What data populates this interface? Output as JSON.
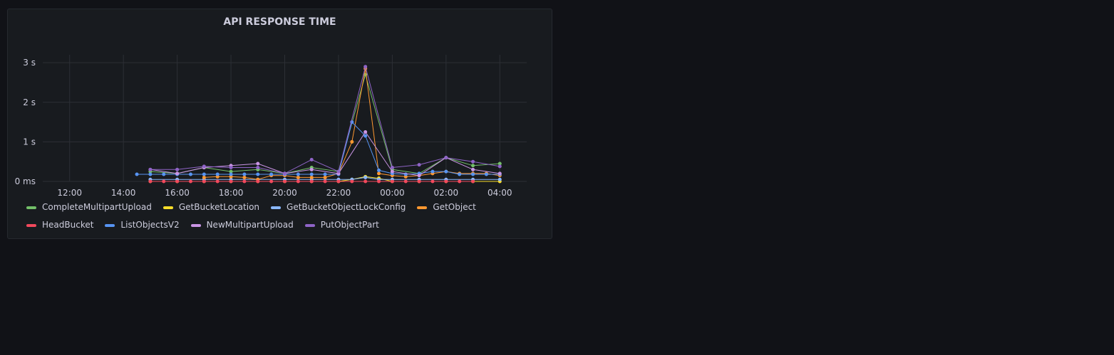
{
  "panel": {
    "title": "API RESPONSE TIME"
  },
  "chart_data": {
    "type": "line",
    "title": "API RESPONSE TIME",
    "xlabel": "",
    "ylabel": "",
    "x_tick_labels": [
      "12:00",
      "14:00",
      "16:00",
      "18:00",
      "20:00",
      "22:00",
      "00:00",
      "02:00",
      "04:00"
    ],
    "x_tick_hours": [
      12,
      14,
      16,
      18,
      20,
      22,
      24,
      26,
      28
    ],
    "xlim_hours": [
      11,
      29
    ],
    "y_ticks": [
      0,
      1,
      2,
      3
    ],
    "y_tick_labels": [
      "0 ms",
      "1 s",
      "2 s",
      "3 s"
    ],
    "ylim": [
      0,
      3.2
    ],
    "grid": true,
    "legend_position": "bottom",
    "series": [
      {
        "name": "CompleteMultipartUpload",
        "color": "#73bf69",
        "x": [
          15,
          16,
          17,
          18,
          19,
          20,
          21,
          22,
          23,
          24,
          25,
          26,
          27,
          28
        ],
        "y": [
          0.25,
          0.2,
          0.35,
          0.25,
          0.3,
          0.2,
          0.35,
          0.25,
          2.7,
          0.3,
          0.2,
          0.6,
          0.4,
          0.45
        ]
      },
      {
        "name": "GetBucketLocation",
        "color": "#fade2a",
        "x": [
          15,
          16,
          17,
          18,
          19,
          20,
          21,
          22,
          22.5,
          23,
          23.5,
          24,
          25,
          26,
          27,
          28
        ],
        "y": [
          0,
          0,
          0,
          0,
          0,
          0,
          0,
          0,
          0.05,
          0.12,
          0.08,
          0,
          0,
          0,
          0,
          0
        ]
      },
      {
        "name": "GetBucketObjectLockConfig",
        "color": "#8ab8ff",
        "x": [
          15,
          16,
          17,
          18,
          19,
          20,
          21,
          22,
          22.5,
          23,
          23.5,
          24,
          25,
          26,
          27,
          28
        ],
        "y": [
          0.05,
          0.05,
          0.05,
          0.05,
          0.05,
          0.05,
          0.05,
          0.05,
          0.05,
          0.1,
          0.05,
          0.05,
          0.05,
          0.05,
          0.05,
          0.05
        ]
      },
      {
        "name": "GetObject",
        "color": "#ff9830",
        "x": [
          17,
          17.5,
          18,
          18.5,
          19,
          19.5,
          20,
          20.5,
          21,
          21.5,
          22,
          22.5,
          23,
          23.5,
          24,
          24.5,
          25,
          25.5,
          26,
          26.5,
          27,
          27.5,
          28
        ],
        "y": [
          0.1,
          0.12,
          0.12,
          0.1,
          0.05,
          0.15,
          0.15,
          0.1,
          0.1,
          0.1,
          0.2,
          1.0,
          2.85,
          0.2,
          0.15,
          0.12,
          0.15,
          0.2,
          0.25,
          0.2,
          0.2,
          0.2,
          0.15
        ]
      },
      {
        "name": "HeadBucket",
        "color": "#f2495c",
        "x": [
          15,
          15.5,
          16,
          16.5,
          17,
          17.5,
          18,
          18.5,
          19,
          19.5,
          20,
          20.5,
          21,
          21.5,
          22,
          22.5,
          23,
          23.5,
          24,
          24.5,
          25,
          25.5,
          26,
          26.5,
          27
        ],
        "y": [
          0,
          0,
          0,
          0,
          0,
          0,
          0,
          0,
          0,
          0,
          0,
          0,
          0,
          0,
          0,
          0,
          0,
          0,
          0,
          0,
          0,
          0,
          0,
          0,
          0
        ]
      },
      {
        "name": "ListObjectsV2",
        "color": "#5794f2",
        "x": [
          14.5,
          15,
          15.5,
          16,
          16.5,
          17,
          17.5,
          18,
          18.5,
          19,
          19.5,
          20,
          20.5,
          21,
          21.5,
          22,
          22.5,
          23,
          23.5,
          24,
          24.5,
          25,
          25.5,
          26,
          26.5,
          27,
          27.5,
          28
        ],
        "y": [
          0.18,
          0.18,
          0.18,
          0.18,
          0.18,
          0.18,
          0.18,
          0.18,
          0.18,
          0.18,
          0.18,
          0.18,
          0.18,
          0.18,
          0.18,
          0.18,
          1.5,
          1.15,
          0.28,
          0.2,
          0.18,
          0.2,
          0.25,
          0.25,
          0.18,
          0.18,
          0.18,
          0.18
        ]
      },
      {
        "name": "NewMultipartUpload",
        "color": "#ca95e5",
        "x": [
          15,
          16,
          17,
          18,
          19,
          20,
          21,
          22,
          23,
          24,
          25,
          26,
          27,
          28
        ],
        "y": [
          0.3,
          0.2,
          0.35,
          0.4,
          0.45,
          0.2,
          0.3,
          0.2,
          1.25,
          0.25,
          0.15,
          0.6,
          0.3,
          0.2
        ]
      },
      {
        "name": "PutObjectPart",
        "color": "#8f64c7",
        "x": [
          15,
          16,
          17,
          18,
          19,
          20,
          21,
          22,
          23,
          24,
          25,
          26,
          27,
          28
        ],
        "y": [
          0.3,
          0.3,
          0.38,
          0.35,
          0.35,
          0.2,
          0.55,
          0.25,
          2.9,
          0.35,
          0.42,
          0.6,
          0.5,
          0.38
        ]
      }
    ]
  }
}
